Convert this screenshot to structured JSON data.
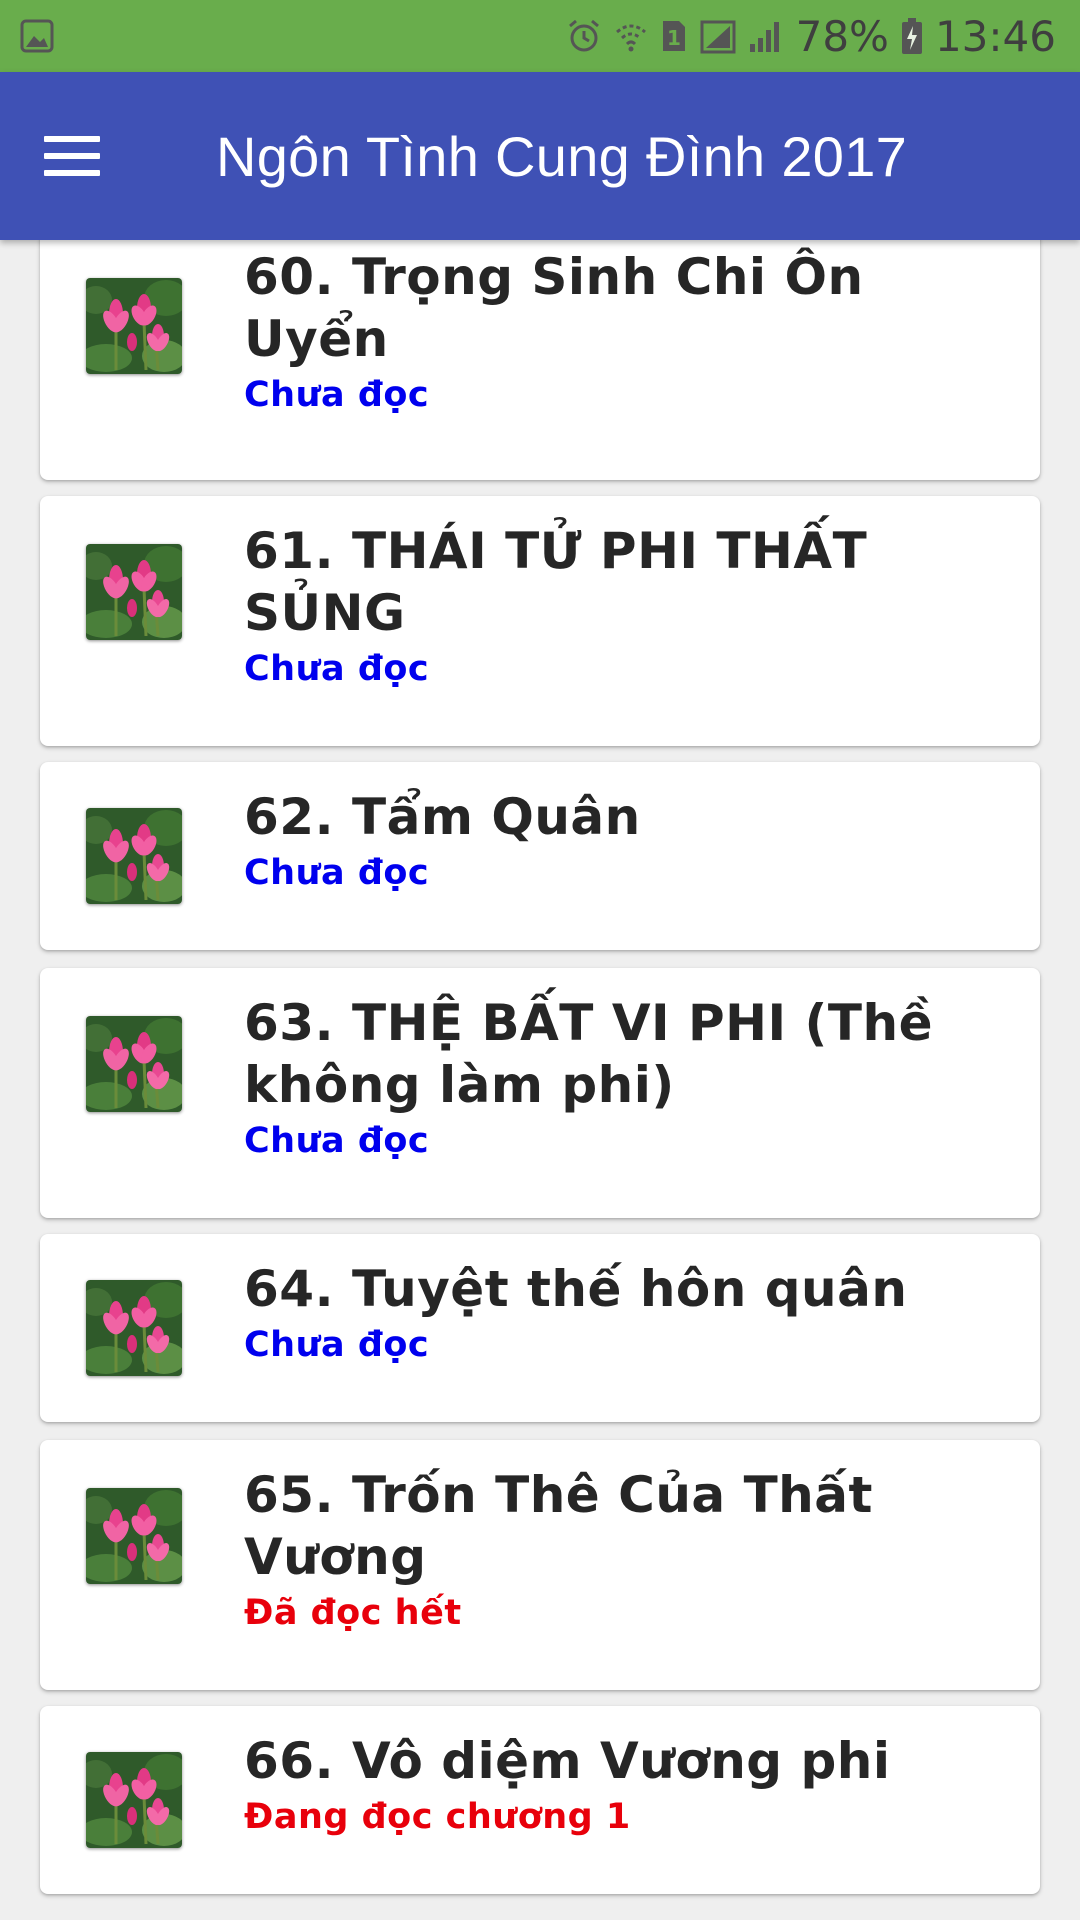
{
  "status_bar": {
    "battery": "78%",
    "time": "13:46",
    "sim_slot": "1",
    "icons": [
      "image-icon",
      "alarm-icon",
      "wifi-icon",
      "sim-icon",
      "signal-icon",
      "signal-icon",
      "battery-charging-icon"
    ]
  },
  "app_bar": {
    "title": "Ngôn Tình Cung Đình 2017",
    "menu_icon": "hamburger-menu-icon"
  },
  "colors": {
    "status_bar": "#69ad4c",
    "app_bar": "#3f51b5",
    "unread": "#0000ee",
    "read": "#e8000b"
  },
  "stories": [
    {
      "title": "60. Trọng Sinh Chi Ôn Uyển",
      "status": "Chưa đọc",
      "status_type": "unread",
      "thumbnail": "lotus-flower-thumbnail"
    },
    {
      "title": "61. THÁI TỬ PHI THẤT SỦNG",
      "status": "Chưa đọc",
      "status_type": "unread",
      "thumbnail": "lotus-flower-thumbnail"
    },
    {
      "title": "62. Tẩm Quân",
      "status": "Chưa đọc",
      "status_type": "unread",
      "thumbnail": "lotus-flower-thumbnail"
    },
    {
      "title": "63. THỆ BẤT VI PHI (Thề không làm phi)",
      "status": "Chưa đọc",
      "status_type": "unread",
      "thumbnail": "lotus-flower-thumbnail"
    },
    {
      "title": "64. Tuyệt thế hôn quân",
      "status": "Chưa đọc",
      "status_type": "unread",
      "thumbnail": "lotus-flower-thumbnail"
    },
    {
      "title": "65. Trốn Thê Của Thất Vương",
      "status": "Đã đọc hết",
      "status_type": "read",
      "thumbnail": "lotus-flower-thumbnail"
    },
    {
      "title": "66. Vô diệm Vương phi",
      "status": "Đang đọc chương 1",
      "status_type": "read",
      "thumbnail": "lotus-flower-thumbnail"
    }
  ]
}
